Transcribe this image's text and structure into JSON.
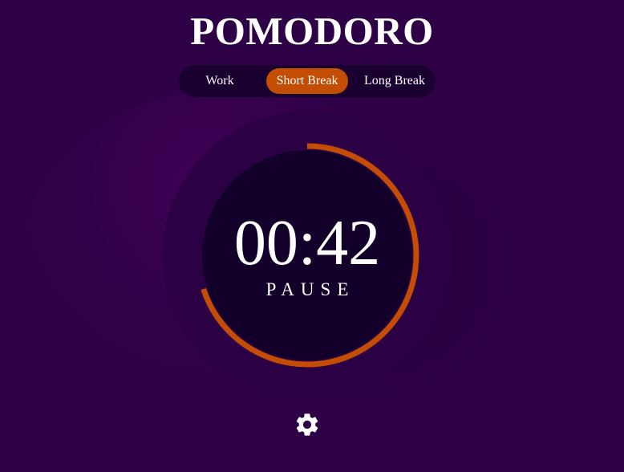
{
  "app": {
    "title": "POMODORO"
  },
  "tabs": [
    {
      "label": "Work",
      "active": false
    },
    {
      "label": "Short Break",
      "active": true
    },
    {
      "label": "Long Break",
      "active": false
    }
  ],
  "timer": {
    "time": "00:42",
    "action_label": "PAUSE",
    "progress_fraction": 0.7
  },
  "settings": {
    "icon": "gear-icon"
  },
  "colors": {
    "background": "#2e0046",
    "accent": "#c44d04",
    "timer_face": "#13002a",
    "tab_bar": "#1a0030"
  }
}
